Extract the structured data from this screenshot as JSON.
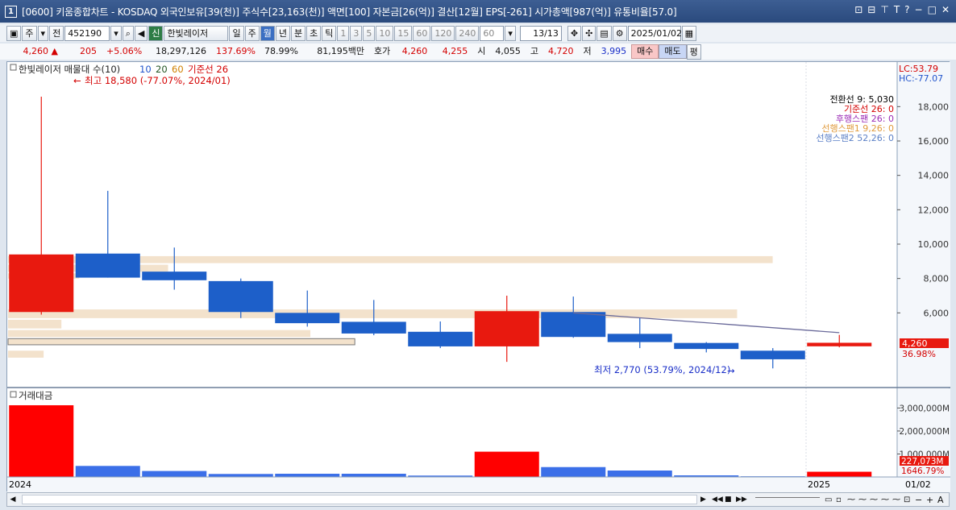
{
  "window": {
    "number": "1",
    "title": "[0600] 키움종합차트 - KOSDAQ 외국인보유[39(천)] 주식수[23,163(천)] 액면[100] 자본금[26(억)] 결산[12월] EPS[-261] 시가총액[987(억)] 유통비율[57.0]"
  },
  "toolbar": {
    "market": "주",
    "all": "전",
    "code": "452190",
    "badge": "신",
    "stock_name": "한빛레이저",
    "periods": [
      "일",
      "주",
      "월",
      "년"
    ],
    "active_period": "월",
    "intraday": [
      "분",
      "초",
      "틱"
    ],
    "intervals": [
      "1",
      "3",
      "5",
      "10",
      "15",
      "60",
      "120",
      "240"
    ],
    "interval_value": "60",
    "count": "13/13",
    "date": "2025/01/02"
  },
  "quote": {
    "price": "4,260",
    "arrow": "▲",
    "change": "205",
    "change_pct": "+5.06%",
    "volume": "18,297,126",
    "vol_ratio": "137.69%",
    "turnover": "78.99%",
    "amount": "81,195백만",
    "ask_label": "호가",
    "ask1": "4,260",
    "ask2": "4,255",
    "open_label": "시",
    "open": "4,055",
    "high_label": "고",
    "high": "4,720",
    "low_label": "저",
    "low": "3,995",
    "buy": "매수",
    "sell": "매도",
    "flat": "평"
  },
  "price_panel": {
    "legend_name": "한빛레이저 매물대 수(10)",
    "ma": [
      "10",
      "20",
      "60"
    ],
    "base_label": "기준선 26",
    "max_note": "최고 18,580 (-77.07%, 2024/01)",
    "min_note": "최저 2,770 (53.79%, 2024/12)",
    "lc": "LC:53.79",
    "hc": "HC:-77.07",
    "ichimoku": [
      {
        "label": "전환선 9: 5,030",
        "color": "#000000"
      },
      {
        "label": "기준선 26: 0",
        "color": "#d40000"
      },
      {
        "label": "후행스팬 26: 0",
        "color": "#9b2bb5"
      },
      {
        "label": "선행스팬1 9,26: 0",
        "color": "#e09b3d"
      },
      {
        "label": "선행스팬2 52,26: 0",
        "color": "#5a7fc6"
      }
    ],
    "yticks": [
      "18,000",
      "16,000",
      "14,000",
      "12,000",
      "10,000",
      "8,000",
      "6,000"
    ],
    "current_price": "4,260",
    "current_pct": "36.98%"
  },
  "volume_panel": {
    "label": "거래대금",
    "yticks": [
      "3,000,000M",
      "2,000,000M",
      "1,000,000M"
    ],
    "current": "227,073M",
    "current_pct": "1646.79%"
  },
  "xaxis": {
    "labels": [
      "2024",
      "2025"
    ],
    "date_right": "01/02"
  },
  "chart_data": {
    "type": "candlestick",
    "categories": [
      "2024/01",
      "2024/02",
      "2024/03",
      "2024/04",
      "2024/05",
      "2024/06",
      "2024/07",
      "2024/08",
      "2024/09",
      "2024/10",
      "2024/11",
      "2024/12",
      "2025/01"
    ],
    "open": [
      6050,
      9450,
      8400,
      7850,
      6000,
      5480,
      4900,
      4050,
      6050,
      4780,
      4250,
      3800,
      4055
    ],
    "high": [
      18580,
      13100,
      9800,
      8000,
      7300,
      6750,
      5500,
      7000,
      6950,
      5700,
      4300,
      3950,
      4720
    ],
    "low": [
      5900,
      8050,
      7350,
      5700,
      5200,
      4700,
      3950,
      3150,
      4550,
      3950,
      3700,
      2770,
      3995
    ],
    "close": [
      9400,
      8050,
      7900,
      6050,
      5400,
      4800,
      4050,
      6100,
      4600,
      4300,
      3900,
      3300,
      4260
    ],
    "turnover_m": [
      3120000,
      480000,
      260000,
      130000,
      140000,
      140000,
      60000,
      1100000,
      430000,
      280000,
      70000,
      30000,
      227073
    ],
    "conversion_line": {
      "x": [
        "2024/09",
        "2025/01"
      ],
      "values": [
        6000,
        4850
      ]
    },
    "ylim": [
      2500,
      19000
    ],
    "volume_ylim": [
      0,
      3400000
    ],
    "volume_profile": [
      {
        "low": 8800,
        "high": 9300,
        "volume": 86
      },
      {
        "low": 8300,
        "high": 8800,
        "volume": 18
      },
      {
        "low": 7900,
        "high": 8300,
        "volume": 8
      },
      {
        "low": 5600,
        "high": 6200,
        "volume": 82
      },
      {
        "low": 5000,
        "high": 5600,
        "volume": 6
      },
      {
        "low": 4500,
        "high": 5000,
        "volume": 34
      },
      {
        "low": 4050,
        "high": 4500,
        "volume": 39
      },
      {
        "low": 3300,
        "high": 3800,
        "volume": 4
      }
    ],
    "colors": {
      "up": "#e8190f",
      "down": "#1d5fc9",
      "volume_up": "#ff0000",
      "volume_down": "#3b6fe8",
      "profile": "#f3e2cc"
    }
  }
}
